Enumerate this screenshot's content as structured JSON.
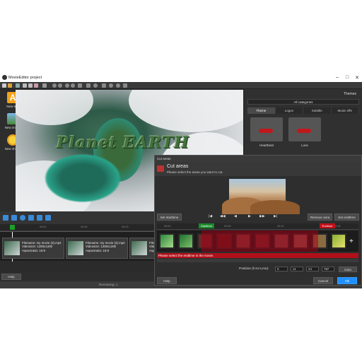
{
  "app": {
    "title": "MovieEditor project",
    "statusbar_text": "Remaining: 1"
  },
  "left_tools": [
    {
      "label": "New text",
      "icon": "text-icon"
    },
    {
      "label": "New image",
      "icon": "image-icon"
    },
    {
      "label": "New shape",
      "icon": "shape-icon"
    }
  ],
  "preview": {
    "title_text": "Planet EARTH"
  },
  "themes_panel": {
    "title": "Themes",
    "category": "All categories",
    "tabs": [
      "Theme",
      "Logos",
      "Subtitle",
      "Music effe"
    ],
    "items": [
      {
        "label": "Heartbeat"
      },
      {
        "label": "Love"
      }
    ]
  },
  "timeline": {
    "ruler_ticks": [
      "00:00",
      "00:05",
      "00:10"
    ],
    "clips": [
      {
        "filename": "Filename: my movie (3).mp4",
        "videosize": "Videosize: 1280x1280",
        "aspect": "Aspectratio: 16:9"
      },
      {
        "filename": "Filename: my movie (3).mp4",
        "videosize": "Videosize: 1280x1280",
        "aspect": "Aspectratio: 16:9"
      },
      {
        "filename": "Filen",
        "videosize": "Video",
        "aspect": "Aspec"
      }
    ],
    "help_label": "Help"
  },
  "dialog": {
    "window_title": "Cut areas",
    "heading": "Cut areas",
    "subheading": "Please select the areas you want to cut.",
    "set_start": "Set starttime",
    "remove_area": "Remove area",
    "set_end": "Set endtime",
    "marker_start": "Starttime",
    "marker_end": "Endtime",
    "error_text": "Please select the endtime in the movie.",
    "position_label": "Position (h:m:s,ms):",
    "position_values": [
      "0",
      "11",
      "24",
      "787"
    ],
    "goto_label": "Goto",
    "help_label": "Help",
    "cancel_label": "Cancel",
    "ok_label": "Ok",
    "ruler_ticks": [
      "00:00",
      "00:05",
      "00:10",
      "00:15"
    ],
    "transport_labels": [
      "|◀",
      "◀◀",
      "◀",
      "▶",
      "▶▶",
      "▶|"
    ]
  },
  "colors": {
    "accent": "#1e90ff",
    "cut_red": "#b0101a",
    "start_green": "#1a8a2a"
  }
}
